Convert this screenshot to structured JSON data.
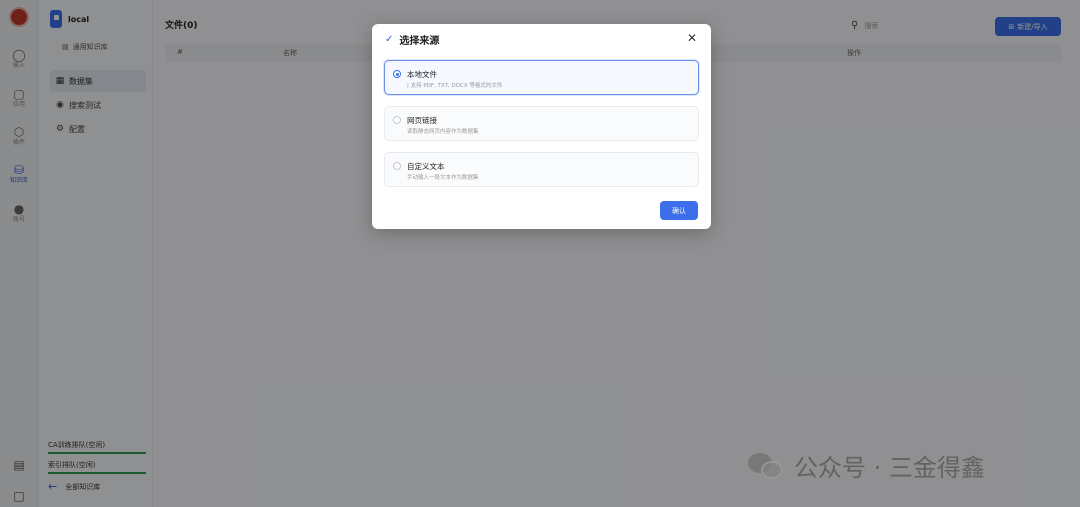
{
  "rail": {
    "items": [
      {
        "icon": "chat-icon",
        "label": "输入"
      },
      {
        "icon": "robot-icon",
        "label": "应用"
      },
      {
        "icon": "plugin-icon",
        "label": "插件"
      },
      {
        "icon": "database-icon",
        "label": "知识库",
        "active": true
      },
      {
        "icon": "user-icon",
        "label": "账号"
      }
    ]
  },
  "sidebar": {
    "title": "local",
    "subtitle": "通用知识库",
    "nav": [
      {
        "icon": "dataset-icon",
        "label": "数据集",
        "active": true
      },
      {
        "icon": "test-icon",
        "label": "搜索测试"
      },
      {
        "icon": "settings-icon",
        "label": "配置"
      }
    ],
    "footer": {
      "link1": "CA训练排队(空闲)",
      "link2": "索引排队(空闲)",
      "back": "全部知识库"
    }
  },
  "main": {
    "title": "文件(0)",
    "search_placeholder": "搜索",
    "create_button": "新建/导入",
    "table_headers": {
      "index": "#",
      "name": "名称",
      "action": "操作"
    }
  },
  "modal": {
    "title": "选择来源",
    "options": [
      {
        "label": "本地文件",
        "desc": "| 支持 PDF, TXT, DOCX 等格式的文件",
        "selected": true
      },
      {
        "label": "网页链接",
        "desc": "读取静态网页内容作为数据集"
      },
      {
        "label": "自定义文本",
        "desc": "手动输入一段文本作为数据集"
      }
    ],
    "confirm": "确认"
  },
  "watermark": {
    "text": "公众号 · 三金得鑫"
  }
}
